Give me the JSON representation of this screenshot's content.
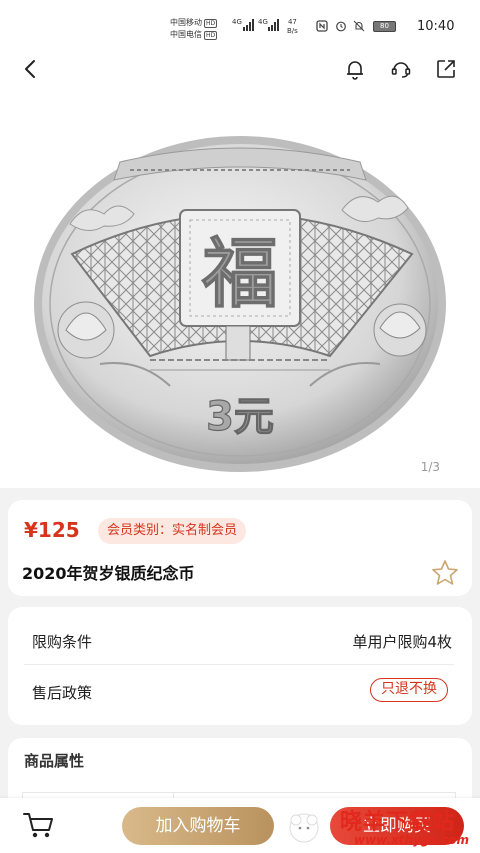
{
  "status_bar": {
    "carrier1": "中国移动",
    "carrier2": "中国电信",
    "hd": "HD",
    "net": "4G",
    "speed_value": "47",
    "speed_unit": "B/s",
    "battery": "80",
    "time": "10:40"
  },
  "header": {
    "back_icon": "chevron-left-icon",
    "bell_icon": "bell-icon",
    "support_icon": "headset-icon",
    "share_icon": "share-icon"
  },
  "gallery": {
    "coin_character": "福",
    "coin_value": "3元",
    "pager": "1/3"
  },
  "product": {
    "price": "¥125",
    "member_badge": "会员类别：实名制会员",
    "title": "2020年贺岁银质纪念币"
  },
  "policy": {
    "limit_label": "限购条件",
    "limit_value": "单用户限购4枚",
    "after_sale_label": "售后政策",
    "after_sale_value": "只退不换"
  },
  "attributes": {
    "title": "商品属性"
  },
  "bottom_bar": {
    "add_to_cart": "加入购物车",
    "buy_now": "立即购买"
  },
  "watermark": {
    "title": "晓羊下载站",
    "url": "www.xthygs.com"
  },
  "colors": {
    "accent": "#d4351c",
    "gold": "#c9a670",
    "badge_bg": "#fde7e1"
  }
}
